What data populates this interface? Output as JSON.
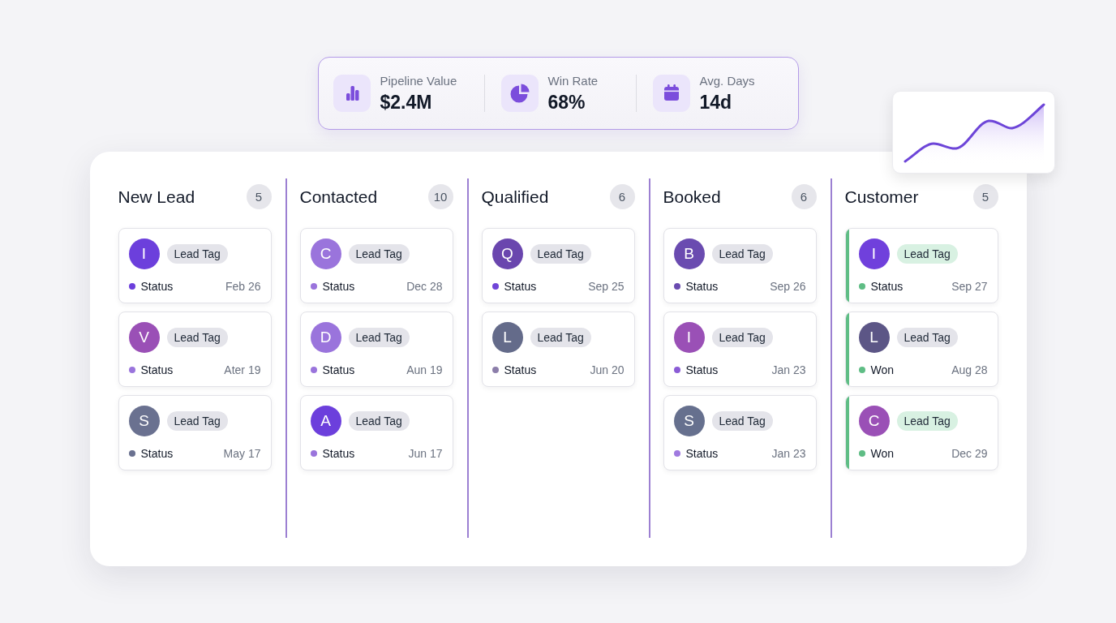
{
  "stats": [
    {
      "kind": "value",
      "label": "Pipeline Value",
      "value": "$2.4M"
    },
    {
      "kind": "rate",
      "label": "Win Rate",
      "value": "68%"
    },
    {
      "kind": "duration",
      "label": "Avg. Days",
      "value": "14d"
    }
  ],
  "trend_card": {
    "kind": "sparkline"
  },
  "columns": [
    {
      "title": "New Lead",
      "count": "5",
      "cards": [
        {
          "avatar": {
            "initial": "I",
            "color": "#6c3fdc"
          },
          "tag": {
            "label": "Lead Tag",
            "color": "#e4e4ea"
          },
          "status": {
            "label": "Status",
            "color": "#6c3fdc"
          },
          "date": "Feb 26"
        },
        {
          "avatar": {
            "initial": "V",
            "color": "#9a50b6"
          },
          "tag": {
            "label": "Lead Tag",
            "color": "#e4e4ea"
          },
          "status": {
            "label": "Status",
            "color": "#9a74dc"
          },
          "date": "Ater 19"
        },
        {
          "avatar": {
            "initial": "S",
            "color": "#6a7190"
          },
          "tag": {
            "label": "Lead Tag",
            "color": "#e4e4ea"
          },
          "status": {
            "label": "Status",
            "color": "#6a7190"
          },
          "date": "May 17"
        }
      ]
    },
    {
      "title": "Contacted",
      "count": "10",
      "cards": [
        {
          "avatar": {
            "initial": "C",
            "color": "#9a74dc"
          },
          "tag": {
            "label": "Lead Tag",
            "color": "#e4e4ea"
          },
          "status": {
            "label": "Status",
            "color": "#9a74dc"
          },
          "date": "Dec 28"
        },
        {
          "avatar": {
            "initial": "D",
            "color": "#9a74dc"
          },
          "tag": {
            "label": "Lead Tag",
            "color": "#e4e4ea"
          },
          "status": {
            "label": "Status",
            "color": "#9a74dc"
          },
          "date": "Aun 19"
        },
        {
          "avatar": {
            "initial": "A",
            "color": "#6c3fdc"
          },
          "tag": {
            "label": "Lead Tag",
            "color": "#e4e4ea"
          },
          "status": {
            "label": "Status",
            "color": "#9a74dc"
          },
          "date": "Jun 17"
        }
      ]
    },
    {
      "title": "Qualified",
      "count": "6",
      "cards": [
        {
          "avatar": {
            "initial": "Q",
            "color": "#6a46ae"
          },
          "tag": {
            "label": "Lead Tag",
            "color": "#e4e4ea"
          },
          "status": {
            "label": "Status",
            "color": "#7045d8"
          },
          "date": "Sep 25"
        },
        {
          "avatar": {
            "initial": "L",
            "color": "#646b8a"
          },
          "tag": {
            "label": "Lead Tag",
            "color": "#e4e4ea"
          },
          "status": {
            "label": "Status",
            "color": "#8c7eaa"
          },
          "date": "Jun 20"
        }
      ]
    },
    {
      "title": "Booked",
      "count": "6",
      "cards": [
        {
          "avatar": {
            "initial": "B",
            "color": "#6a4bb0"
          },
          "tag": {
            "label": "Lead Tag",
            "color": "#e4e4ea"
          },
          "status": {
            "label": "Status",
            "color": "#6a4bb0"
          },
          "date": "Sep 26"
        },
        {
          "avatar": {
            "initial": "I",
            "color": "#9a50b6"
          },
          "tag": {
            "label": "Lead Tag",
            "color": "#e4e4ea"
          },
          "status": {
            "label": "Status",
            "color": "#8b5cd6"
          },
          "date": "Jan 23"
        },
        {
          "avatar": {
            "initial": "S",
            "color": "#66708e"
          },
          "tag": {
            "label": "Lead Tag",
            "color": "#e4e4ea"
          },
          "status": {
            "label": "Status",
            "color": "#a07ae0"
          },
          "date": "Jan 23"
        }
      ]
    },
    {
      "title": "Customer",
      "count": "5",
      "cards": [
        {
          "stripe": {
            "color": "#5fbd85"
          },
          "avatar": {
            "initial": "I",
            "color": "#7040dc"
          },
          "tag": {
            "label": "Lead Tag",
            "color": "#d8f1e2"
          },
          "status": {
            "label": "Status",
            "color": "#5fbd85"
          },
          "date": "Sep 27"
        },
        {
          "stripe": {
            "color": "#5fbd85"
          },
          "avatar": {
            "initial": "L",
            "color": "#5c5686"
          },
          "tag": {
            "label": "Lead Tag",
            "color": "#e4e4ea"
          },
          "status": {
            "label": "Won",
            "color": "#5fbd85"
          },
          "date": "Aug 28"
        },
        {
          "stripe": {
            "color": "#5fbd85"
          },
          "avatar": {
            "initial": "C",
            "color": "#9a50b6"
          },
          "tag": {
            "label": "Lead Tag",
            "color": "#d8f1e2"
          },
          "status": {
            "label": "Won",
            "color": "#5fbd85"
          },
          "date": "Dec 29"
        }
      ]
    }
  ]
}
